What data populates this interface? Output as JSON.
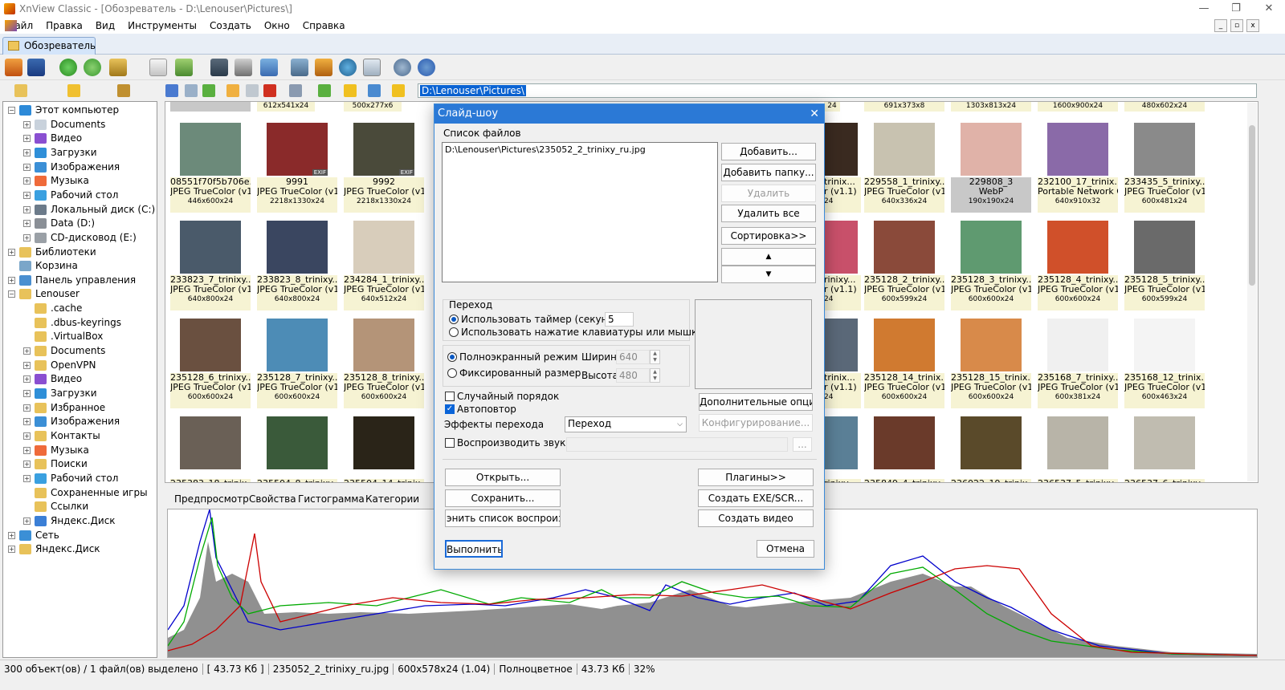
{
  "window": {
    "title": "XnView Classic - [Обозреватель - D:\\Lenouser\\Pictures\\]",
    "minimize": "—",
    "maximize": "❐",
    "close": "✕"
  },
  "menu": [
    "Файл",
    "Правка",
    "Вид",
    "Инструменты",
    "Создать",
    "Окно",
    "Справка"
  ],
  "tab": "Обозреватель",
  "address": "D:\\Lenouser\\Pictures\\",
  "tree": [
    {
      "label": "Этот компьютер",
      "color": "#2d8ad8"
    },
    {
      "label": "Documents",
      "color": "#c9d2dc"
    },
    {
      "label": "Видео",
      "color": "#8a4fd1"
    },
    {
      "label": "Загрузки",
      "color": "#2f8fd8"
    },
    {
      "label": "Изображения",
      "color": "#3b8fd6"
    },
    {
      "label": "Музыка",
      "color": "#ef6a3a"
    },
    {
      "label": "Рабочий стол",
      "color": "#3aa0e0"
    },
    {
      "label": "Локальный диск (C:)",
      "color": "#6c7b8a"
    },
    {
      "label": "Data (D:)",
      "color": "#8a8f96"
    },
    {
      "label": "CD-дисковод (E:)",
      "color": "#9aa0a6"
    },
    {
      "label": "Библиотеки",
      "color": "#e8c25a"
    },
    {
      "label": "Корзина",
      "color": "#7aa6c9"
    },
    {
      "label": "Панель управления",
      "color": "#4a8fd0"
    },
    {
      "label": "Lenouser",
      "color": "#e8c25a"
    },
    {
      "label": ".cache",
      "color": "#e8c25a"
    },
    {
      "label": ".dbus-keyrings",
      "color": "#e8c25a"
    },
    {
      "label": ".VirtualBox",
      "color": "#e8c25a"
    },
    {
      "label": "Documents",
      "color": "#e8c25a"
    },
    {
      "label": "OpenVPN",
      "color": "#e8c25a"
    },
    {
      "label": "Видео",
      "color": "#8a4fd1"
    },
    {
      "label": "Загрузки",
      "color": "#2f8fd8"
    },
    {
      "label": "Избранное",
      "color": "#e8c25a"
    },
    {
      "label": "Изображения",
      "color": "#3b8fd6"
    },
    {
      "label": "Контакты",
      "color": "#e8c25a"
    },
    {
      "label": "Музыка",
      "color": "#ef6a3a"
    },
    {
      "label": "Поиски",
      "color": "#e8c25a"
    },
    {
      "label": "Рабочий стол",
      "color": "#3aa0e0"
    },
    {
      "label": "Сохраненные игры",
      "color": "#e8c25a"
    },
    {
      "label": "Ссылки",
      "color": "#e8c25a"
    },
    {
      "label": "Яндекс.Диск",
      "color": "#3b7fd6"
    },
    {
      "label": "Сеть",
      "color": "#3b8fd6"
    },
    {
      "label": "Яндекс.Диск",
      "color": "#e8c25a"
    }
  ],
  "top_row_captions": [
    "612x541x24",
    "500x277x6",
    "24",
    "691x373x8",
    "1303x813x24",
    "1600x900x24",
    "480x602x24"
  ],
  "thumbnails_left": [
    {
      "name": "08551f70f5b706e...",
      "type": "JPEG TrueColor (v1.1)",
      "size": "446x600x24",
      "color": "#6c8a7a"
    },
    {
      "name": "9991",
      "type": "JPEG TrueColor (v1.1)",
      "size": "2218x1330x24",
      "color": "#8a2a2a",
      "exif": "EXIF"
    },
    {
      "name": "9992",
      "type": "JPEG TrueColor (v1.1)",
      "size": "2218x1330x24",
      "color": "#4a4a3a",
      "exif": "EXIF"
    },
    {
      "name": "233823_7_trinixy...",
      "type": "JPEG TrueColor (v1.1)",
      "size": "640x800x24",
      "color": "#4a5a6a"
    },
    {
      "name": "233823_8_trinixy...",
      "type": "JPEG TrueColor (v1.1)",
      "size": "640x800x24",
      "color": "#3a4660"
    },
    {
      "name": "234284_1_trinixy...",
      "type": "JPEG TrueColor (v1.1)",
      "size": "640x512x24",
      "color": "#d8cdbb"
    },
    {
      "name": "235128_6_trinixy...",
      "type": "JPEG TrueColor (v1.1)",
      "size": "600x600x24",
      "color": "#6a5040"
    },
    {
      "name": "235128_7_trinixy...",
      "type": "JPEG TrueColor (v1.1)",
      "size": "600x600x24",
      "color": "#4d8cb6"
    },
    {
      "name": "235128_8_trinixy...",
      "type": "JPEG TrueColor (v1.1)",
      "size": "600x600x24",
      "color": "#b49478"
    },
    {
      "name": "235383_18_trinix...",
      "type": "",
      "size": "",
      "color": "#6a6056"
    },
    {
      "name": "235504_8_trinixy...",
      "type": "",
      "size": "",
      "color": "#3a5a3a"
    },
    {
      "name": "235504_14_trinix...",
      "type": "",
      "size": "",
      "color": "#2a2418"
    }
  ],
  "thumbnails_partial": [
    {
      "name": "trinix...",
      "type": "r (v1.1)",
      "size": "24",
      "color": "#3a2a20"
    },
    {
      "name": "rinixy...",
      "type": "r (v1.1)",
      "size": "24",
      "color": "#c8506a"
    },
    {
      "name": "trinix...",
      "type": "r (v1.1)",
      "size": "24",
      "color": "#5a6878"
    },
    {
      "name": "rinixy...",
      "type": "",
      "size": "",
      "color": "#5a7f96"
    }
  ],
  "thumbnails_right": [
    {
      "name": "229558_1_trinixy...",
      "type": "JPEG TrueColor (v1.1)",
      "size": "640x336x24",
      "color": "#c8c2b0"
    },
    {
      "name": "229808_3",
      "type": "WebP",
      "size": "190x190x24",
      "color": "#e0b2a8",
      "selected": true
    },
    {
      "name": "232100_17_trinix...",
      "type": "Portable Network Gr...",
      "size": "640x910x32",
      "color": "#8a6aa8"
    },
    {
      "name": "233435_5_trinixy...",
      "type": "JPEG TrueColor (v1.1)",
      "size": "600x481x24",
      "color": "#8a8a8a"
    },
    {
      "name": "235128_2_trinixy...",
      "type": "JPEG TrueColor (v1.1)",
      "size": "600x599x24",
      "color": "#8a4a3a"
    },
    {
      "name": "235128_3_trinixy...",
      "type": "JPEG TrueColor (v1.1)",
      "size": "600x600x24",
      "color": "#5f9a70"
    },
    {
      "name": "235128_4_trinixy...",
      "type": "JPEG TrueColor (v1.1)",
      "size": "600x600x24",
      "color": "#d0502a"
    },
    {
      "name": "235128_5_trinixy...",
      "type": "JPEG TrueColor (v1.1)",
      "size": "600x599x24",
      "color": "#6a6a6a"
    },
    {
      "name": "235128_14_trinix...",
      "type": "JPEG TrueColor (v1.1)",
      "size": "600x600x24",
      "color": "#d07a30"
    },
    {
      "name": "235128_15_trinix...",
      "type": "JPEG TrueColor (v1.1)",
      "size": "600x600x24",
      "color": "#d88a4a"
    },
    {
      "name": "235168_7_trinixy...",
      "type": "JPEG TrueColor (v1.1)",
      "size": "600x381x24",
      "color": "#f0f0f0"
    },
    {
      "name": "235168_12_trinix...",
      "type": "JPEG TrueColor (v1.1)",
      "size": "600x463x24",
      "color": "#f4f4f4"
    },
    {
      "name": "235849_4_trinixy...",
      "type": "",
      "size": "",
      "color": "#6a3a2a"
    },
    {
      "name": "236022_19_trinix...",
      "type": "",
      "size": "",
      "color": "#5a4a2a"
    },
    {
      "name": "236537_5_trinixy...",
      "type": "",
      "size": "",
      "color": "#b8b4a8"
    },
    {
      "name": "236537_6_trinixy...",
      "type": "",
      "size": "",
      "color": "#c0bcb0"
    }
  ],
  "preview_tabs": [
    "Предпросмотр",
    "Свойства",
    "Гистограмма",
    "Категории"
  ],
  "status": [
    "300 объект(ов) / 1 файл(ов) выделено",
    "[ 43.73 Кб ]",
    "235052_2_trinixy_ru.jpg",
    "600x578x24 (1.04)",
    "Полноцветное",
    "43.73 Кб",
    "32%"
  ],
  "dialog": {
    "title": "Слайд-шоу",
    "close": "✕",
    "file_list_label": "Список файлов",
    "files": [
      "D:\\Lenouser\\Pictures\\235052_2_trinixy_ru.jpg"
    ],
    "btn_add": "Добавить...",
    "btn_add_folder": "Добавить папку...",
    "btn_delete": "Удалить",
    "btn_delete_all": "Удалить все",
    "btn_sort": "Сортировка>>",
    "btn_up": "▲",
    "btn_down": "▼",
    "transition_group": "Переход",
    "use_timer": "Использовать таймер (секунды)",
    "timer_value": "5",
    "use_keyboard": "Использовать нажатие клавиатуры или мышки",
    "fullscreen": "Полноэкранный режим",
    "fixed_size": "Фиксированный размер",
    "width_label": "Ширина",
    "width_value": "640",
    "height_label": "Высота",
    "height_value": "480",
    "random_order": "Случайный порядок",
    "autorepeat": "Автоповтор",
    "effects_label": "Эффекты перехода",
    "effects_value": "Переход",
    "play_sound": "Воспроизводить звук",
    "btn_more_options": "Дополнительные опции...",
    "btn_configure": "Конфигурирование...",
    "btn_browse": "...",
    "btn_open": "Открыть...",
    "btn_save": "Сохранить...",
    "btn_save_playlist": "энить список воспроизведен",
    "btn_plugins": "Плагины>>",
    "btn_create_exe": "Создать EXE/SCR...",
    "btn_create_video": "Создать видео",
    "btn_run": "Выполнить",
    "btn_cancel": "Отмена"
  },
  "icons": [
    "app-icon",
    "browse-icon",
    "fullscreen-icon",
    "refresh-icon",
    "rotate-icon",
    "move-icon",
    "info-icon",
    "export-icon",
    "binoculars-icon",
    "print-icon",
    "slideshow-icon",
    "capture-icon",
    "monitor-icon",
    "web-icon",
    "grid-icon",
    "settings-icon",
    "about-icon",
    "back-icon",
    "forward-icon",
    "up-icon",
    "new-folder-icon",
    "edit-icon",
    "delete-icon",
    "view-mode-icon",
    "sort-icon",
    "filter-icon",
    "favorites-icon"
  ]
}
